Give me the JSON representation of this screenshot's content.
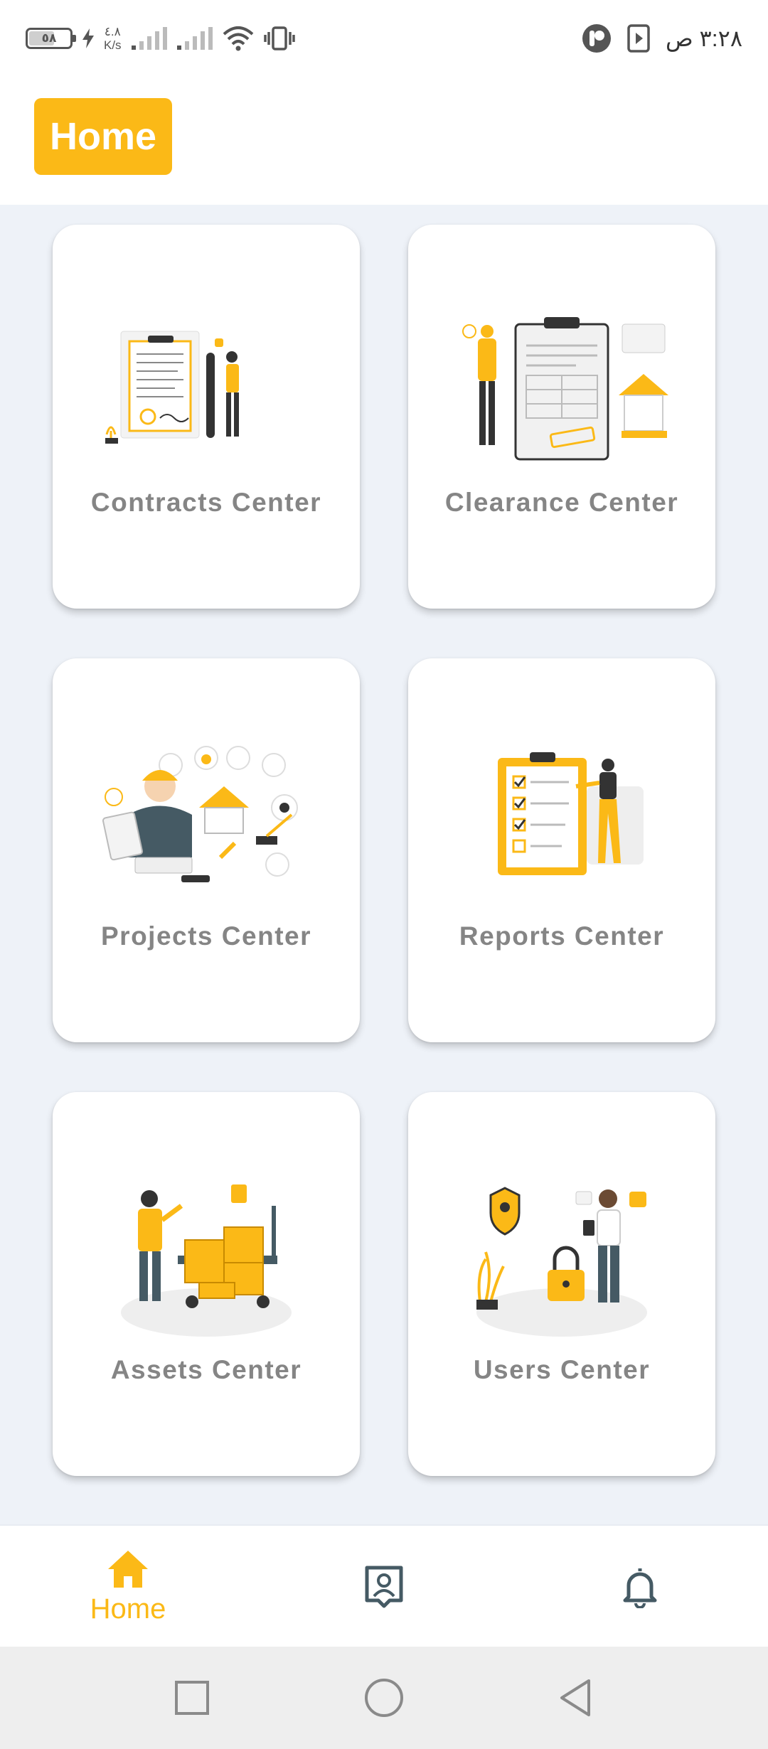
{
  "status_bar": {
    "battery_level": "٥٨",
    "net_speed_value": "٤.٨",
    "net_speed_unit": "K/s",
    "time": "٣:٢٨ ص"
  },
  "header": {
    "title": "Home"
  },
  "cards": [
    {
      "label": "Contracts Center",
      "icon": "contracts-illustration"
    },
    {
      "label": "Clearance Center",
      "icon": "clearance-illustration"
    },
    {
      "label": "Projects Center",
      "icon": "projects-illustration"
    },
    {
      "label": "Reports Center",
      "icon": "reports-illustration"
    },
    {
      "label": "Assets Center",
      "icon": "assets-illustration"
    },
    {
      "label": "Users Center",
      "icon": "users-illustration"
    }
  ],
  "bottom_nav": {
    "items": [
      {
        "label": "Home",
        "icon": "home-icon",
        "active": true
      },
      {
        "label": "",
        "icon": "contact-card-icon",
        "active": false
      },
      {
        "label": "",
        "icon": "bell-icon",
        "active": false
      }
    ]
  },
  "colors": {
    "accent": "#fbb917",
    "background": "#eef2f8",
    "label": "#858585",
    "icon_dark": "#455a64"
  }
}
